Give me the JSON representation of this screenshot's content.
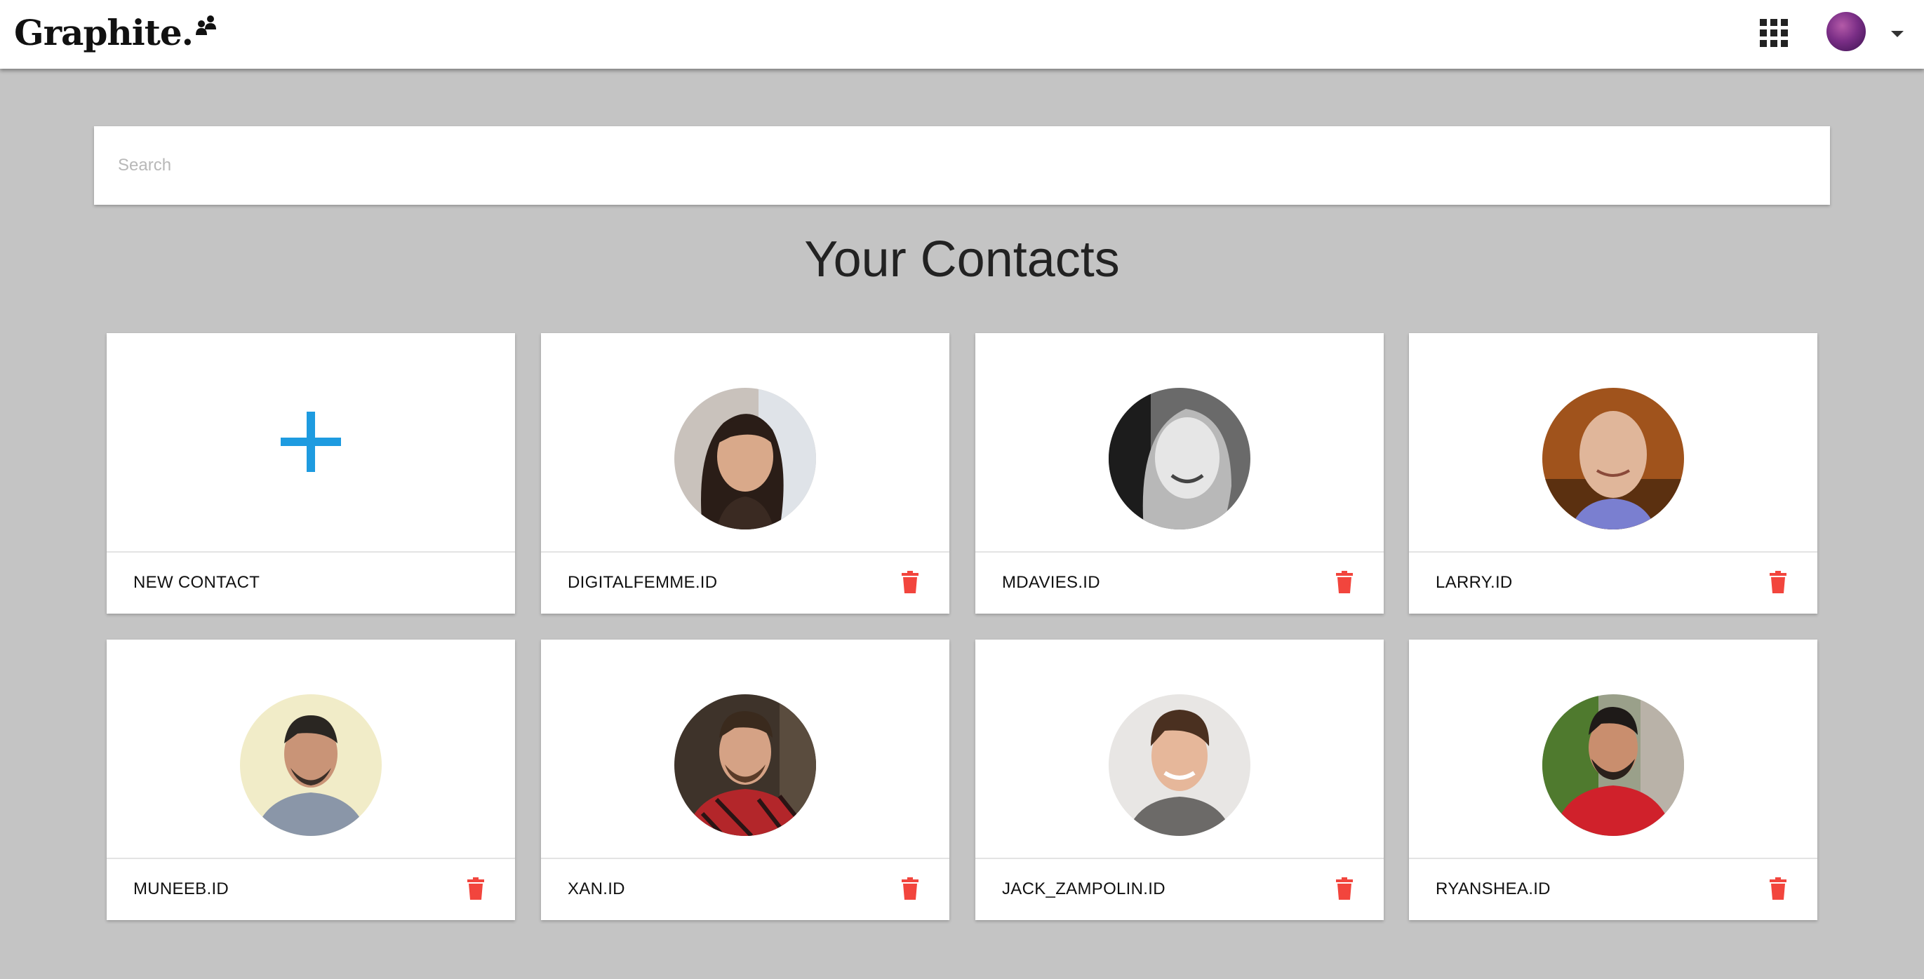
{
  "app": {
    "brand_name": "Graphite.",
    "brand_icon": "people-icon",
    "apps_icon": "grid-icon",
    "user_menu_icon": "caret-down-icon"
  },
  "search": {
    "placeholder": "Search",
    "value": ""
  },
  "page": {
    "title": "Your Contacts"
  },
  "new_contact": {
    "label": "NEW CONTACT",
    "icon": "plus-icon",
    "icon_color": "#1e9be0"
  },
  "contacts": [
    {
      "id": "DIGITALFEMME.ID"
    },
    {
      "id": "MDAVIES.ID"
    },
    {
      "id": "LARRY.ID"
    },
    {
      "id": "MUNEEB.ID"
    },
    {
      "id": "XAN.ID"
    },
    {
      "id": "JACK_ZAMPOLIN.ID"
    },
    {
      "id": "RYANSHEA.ID"
    }
  ],
  "colors": {
    "background": "#c4c4c4",
    "card": "#ffffff",
    "accent": "#1e9be0",
    "delete": "#f2453d",
    "text": "#111111"
  }
}
